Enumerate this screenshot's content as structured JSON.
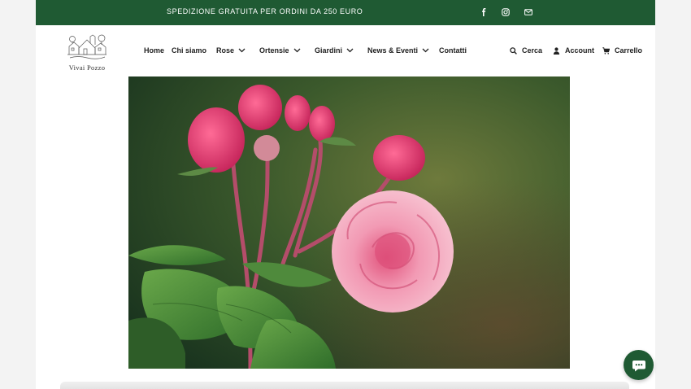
{
  "announcement": {
    "text": "SPEDIZIONE GRATUITA PER ORDINI DA 250 EURO"
  },
  "social": [
    {
      "icon": "facebook-icon"
    },
    {
      "icon": "instagram-icon"
    },
    {
      "icon": "mail-icon"
    }
  ],
  "brand": {
    "name": "Vivai Pozzo"
  },
  "nav": {
    "items": [
      {
        "label": "Home",
        "dropdown": false
      },
      {
        "label": "Chi siamo",
        "dropdown": false
      },
      {
        "label": "Rose",
        "dropdown": true
      },
      {
        "label": "Ortensie",
        "dropdown": true
      },
      {
        "label": "Giardini",
        "dropdown": true
      },
      {
        "label": "News & Eventi",
        "dropdown": true
      },
      {
        "label": "Contatti",
        "dropdown": false
      }
    ]
  },
  "tools": {
    "search_label": "Cerca",
    "account_label": "Account",
    "cart_label": "Carrello"
  },
  "colors": {
    "brand_green": "#1f5a33",
    "text": "#222222"
  }
}
